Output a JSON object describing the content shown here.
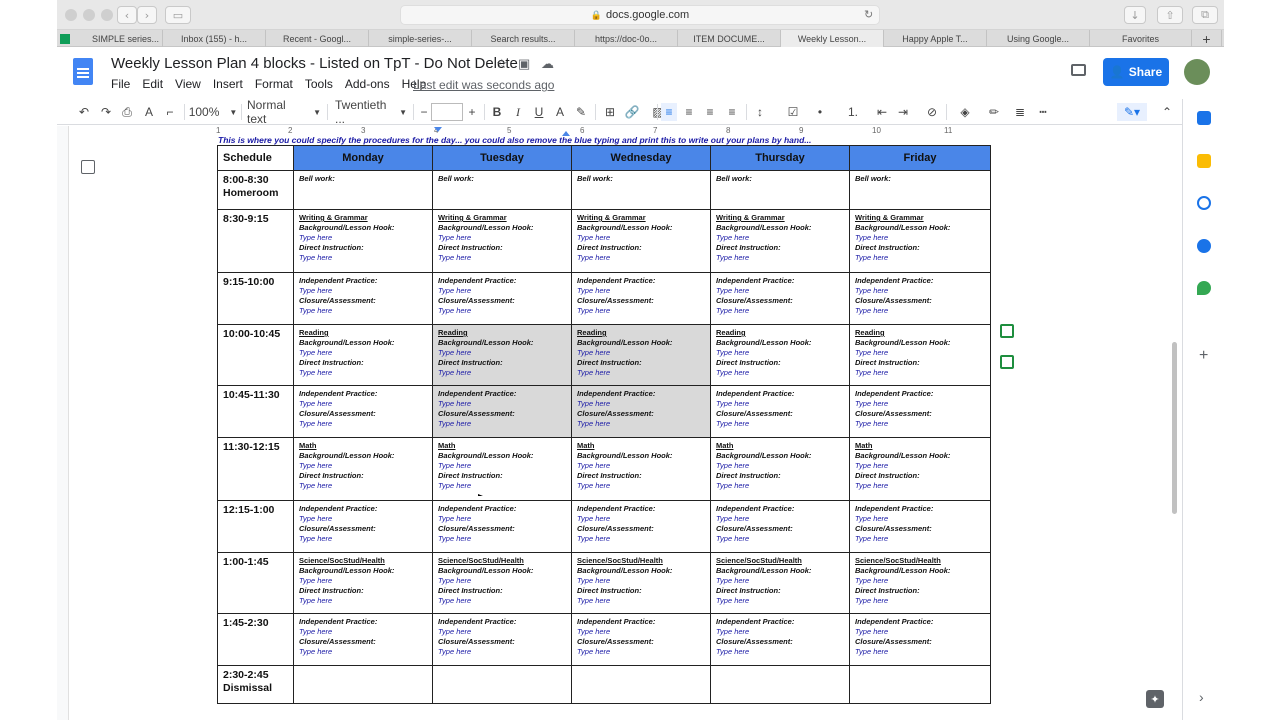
{
  "browser": {
    "url": "docs.google.com",
    "tabs": [
      "SIMPLE series...",
      "Inbox (155) - h...",
      "Recent - Googl...",
      "simple-series-...",
      "Search results...",
      "https://doc-0o...",
      "ITEM DOCUME...",
      "Weekly Lesson...",
      "Happy Apple T...",
      "Using Google...",
      "Favorites"
    ]
  },
  "doc": {
    "title": "Weekly Lesson Plan 4 blocks - Listed on TpT - Do Not Delete",
    "menu": [
      "File",
      "Edit",
      "View",
      "Insert",
      "Format",
      "Tools",
      "Add-ons",
      "Help"
    ],
    "last_edit": "Last edit was seconds ago",
    "share_label": "Share"
  },
  "toolbar": {
    "zoom": "100%",
    "style": "Normal text",
    "font": "Twentieth ...",
    "size": "",
    "bold": "B",
    "italic": "I",
    "underline": "U"
  },
  "ruler": [
    "1",
    "2",
    "3",
    "4",
    "5",
    "6",
    "7",
    "8",
    "9",
    "10",
    "11"
  ],
  "instruction": "This is where you could specify the procedures for the day... you could also remove the blue typing and print this to write out your plans by hand...",
  "table": {
    "header_schedule": "Schedule",
    "days": [
      "Monday",
      "Tuesday",
      "Wednesday",
      "Thursday",
      "Friday"
    ],
    "bell_work": "Bell work:",
    "background_hook": "Background/Lesson Hook:",
    "direct_instruction": "Direct Instruction:",
    "independent_practice": "Independent Practice:",
    "closure": "Closure/Assessment:",
    "type_here": "Type here",
    "times": [
      "8:00-8:30 Homeroom",
      "8:30-9:15",
      "9:15-10:00",
      "10:00-10:45",
      "10:45-11:30",
      "11:30-12:15",
      "12:15-1:00",
      "1:00-1:45",
      "1:45-2:30",
      "2:30-2:45 Dismissal"
    ],
    "subjects": [
      "Writing & Grammar",
      "Reading",
      "Math",
      "Science/SocStud/Health"
    ]
  }
}
